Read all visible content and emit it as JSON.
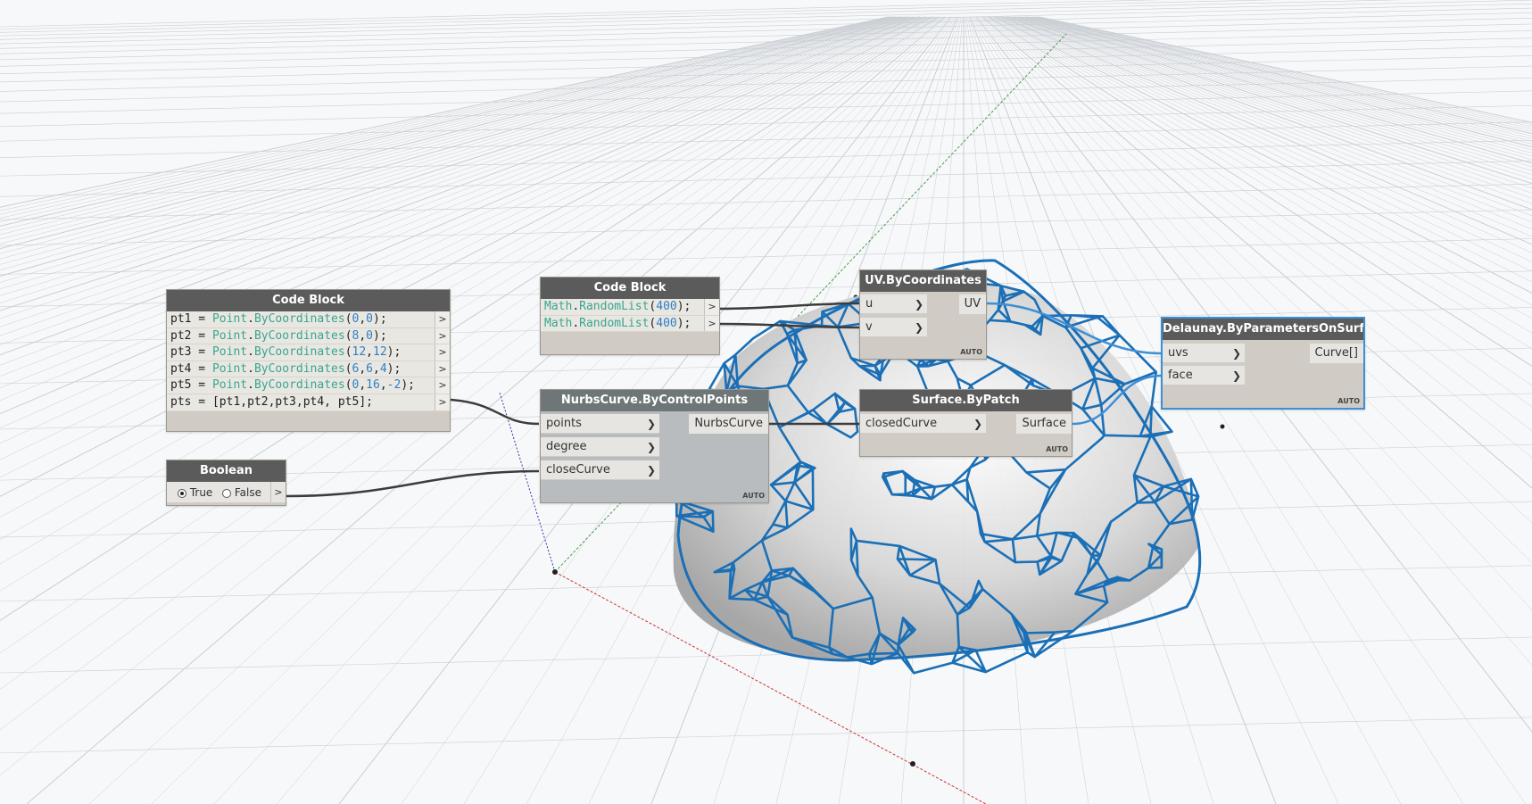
{
  "colors": {
    "canvas_bg": "#f7f8f9",
    "grid": "#c9ced3",
    "node_header": "#5b5b5b",
    "node_body": "#d0ccc5",
    "mesh_blue": "#1a6fb6",
    "wire_dark": "#3c3c3c",
    "wire_blue": "#3d8fd6",
    "axis_x": "#cc3333",
    "axis_y": "#4c9a4c",
    "axis_z": "#3333aa"
  },
  "code_block_points": {
    "title": "Code Block",
    "lines": [
      [
        [
          "pt1 = ",
          "t"
        ],
        [
          "Point",
          "c"
        ],
        [
          ".",
          "t"
        ],
        [
          "ByCoordinates",
          "c"
        ],
        [
          "(",
          "t"
        ],
        [
          "0",
          "n"
        ],
        [
          ",",
          "t"
        ],
        [
          "0",
          "n"
        ],
        [
          ");",
          "t"
        ]
      ],
      [
        [
          "pt2 = ",
          "t"
        ],
        [
          "Point",
          "c"
        ],
        [
          ".",
          "t"
        ],
        [
          "ByCoordinates",
          "c"
        ],
        [
          "(",
          "t"
        ],
        [
          "8",
          "n"
        ],
        [
          ",",
          "t"
        ],
        [
          "0",
          "n"
        ],
        [
          ");",
          "t"
        ]
      ],
      [
        [
          "pt3 = ",
          "t"
        ],
        [
          "Point",
          "c"
        ],
        [
          ".",
          "t"
        ],
        [
          "ByCoordinates",
          "c"
        ],
        [
          "(",
          "t"
        ],
        [
          "12",
          "n"
        ],
        [
          ",",
          "t"
        ],
        [
          "12",
          "n"
        ],
        [
          ");",
          "t"
        ]
      ],
      [
        [
          "pt4 = ",
          "t"
        ],
        [
          "Point",
          "c"
        ],
        [
          ".",
          "t"
        ],
        [
          "ByCoordinates",
          "c"
        ],
        [
          "(",
          "t"
        ],
        [
          "6",
          "n"
        ],
        [
          ",",
          "t"
        ],
        [
          "6",
          "n"
        ],
        [
          ",",
          "t"
        ],
        [
          "4",
          "n"
        ],
        [
          ");",
          "t"
        ]
      ],
      [
        [
          "pt5 = ",
          "t"
        ],
        [
          "Point",
          "c"
        ],
        [
          ".",
          "t"
        ],
        [
          "ByCoordinates",
          "c"
        ],
        [
          "(",
          "t"
        ],
        [
          "0",
          "n"
        ],
        [
          ",",
          "t"
        ],
        [
          "16",
          "n"
        ],
        [
          ",",
          "t"
        ],
        [
          "-2",
          "n"
        ],
        [
          ");",
          "t"
        ]
      ],
      [
        [
          "pts = [pt1,pt2,pt3,pt4, pt5];",
          "t"
        ]
      ]
    ],
    "out_arrow": ">"
  },
  "code_block_random": {
    "title": "Code Block",
    "lines": [
      [
        [
          "Math",
          "c"
        ],
        [
          ".",
          "t"
        ],
        [
          "RandomList",
          "c"
        ],
        [
          "(",
          "t"
        ],
        [
          "400",
          "n"
        ],
        [
          ");",
          "t"
        ]
      ],
      [
        [
          "Math",
          "c"
        ],
        [
          ".",
          "t"
        ],
        [
          "RandomList",
          "c"
        ],
        [
          "(",
          "t"
        ],
        [
          "400",
          "n"
        ],
        [
          ");",
          "t"
        ]
      ]
    ],
    "out_arrow": ">"
  },
  "boolean_node": {
    "title": "Boolean",
    "true_label": "True",
    "false_label": "False",
    "selected": "True",
    "out_arrow": ">"
  },
  "nurbs_node": {
    "title": "NurbsCurve.ByControlPoints",
    "inputs": [
      "points",
      "degree",
      "closeCurve"
    ],
    "output": "NurbsCurve",
    "lacing": "AUTO"
  },
  "uv_node": {
    "title": "UV.ByCoordinates",
    "inputs": [
      "u",
      "v"
    ],
    "output": "UV",
    "lacing": "AUTO"
  },
  "surface_node": {
    "title": "Surface.ByPatch",
    "inputs": [
      "closedCurve"
    ],
    "output": "Surface",
    "lacing": "AUTO"
  },
  "delaunay_node": {
    "title": "Delaunay.ByParametersOnSurface",
    "inputs": [
      "uvs",
      "face"
    ],
    "output": "Curve[]",
    "lacing": "AUTO"
  },
  "chevron": "❯"
}
